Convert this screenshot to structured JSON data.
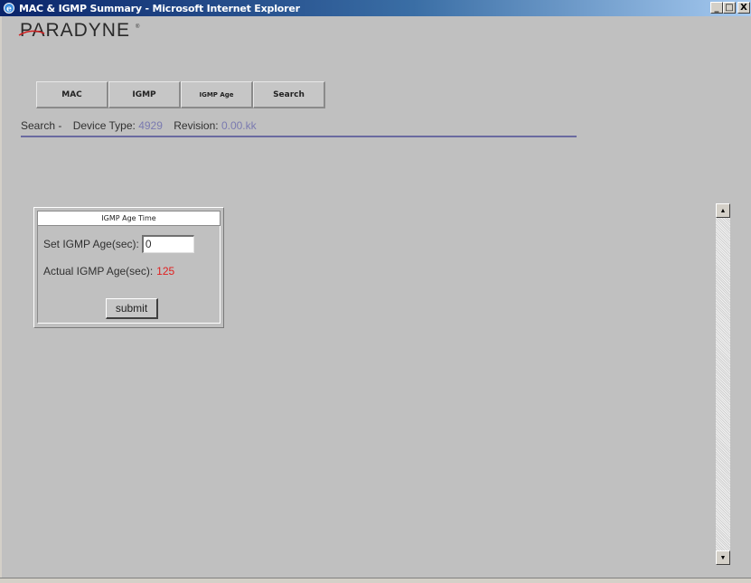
{
  "window": {
    "title": "MAC & IGMP Summary - Microsoft Internet Explorer",
    "minimize_glyph": "_",
    "maximize_glyph": "□",
    "close_glyph": "X"
  },
  "logo": {
    "text": "PARADYNE",
    "registered": "®"
  },
  "nav": {
    "items": [
      {
        "label": "MAC"
      },
      {
        "label": "IGMP"
      },
      {
        "label": "IGMP Age"
      },
      {
        "label": "Search"
      }
    ]
  },
  "info": {
    "prefix": "Search -",
    "device_type_label": "Device Type:",
    "device_type_value": "4929",
    "revision_label": "Revision:",
    "revision_value": "0.00.kk"
  },
  "panel": {
    "title": "IGMP Age Time",
    "set_label": "Set IGMP Age(sec):",
    "set_value": "0",
    "actual_label": "Actual IGMP Age(sec):",
    "actual_value": "125",
    "submit_label": "submit"
  },
  "scrollbar": {
    "up_glyph": "▲",
    "down_glyph": "▼"
  },
  "colors": {
    "titlebar_start": "#0a246a",
    "titlebar_end": "#a6caf0",
    "page_bg": "#c0c0c0",
    "info_value": "#7a7ab0",
    "rule": "#6a6aa0",
    "actual_value": "#e02020"
  }
}
